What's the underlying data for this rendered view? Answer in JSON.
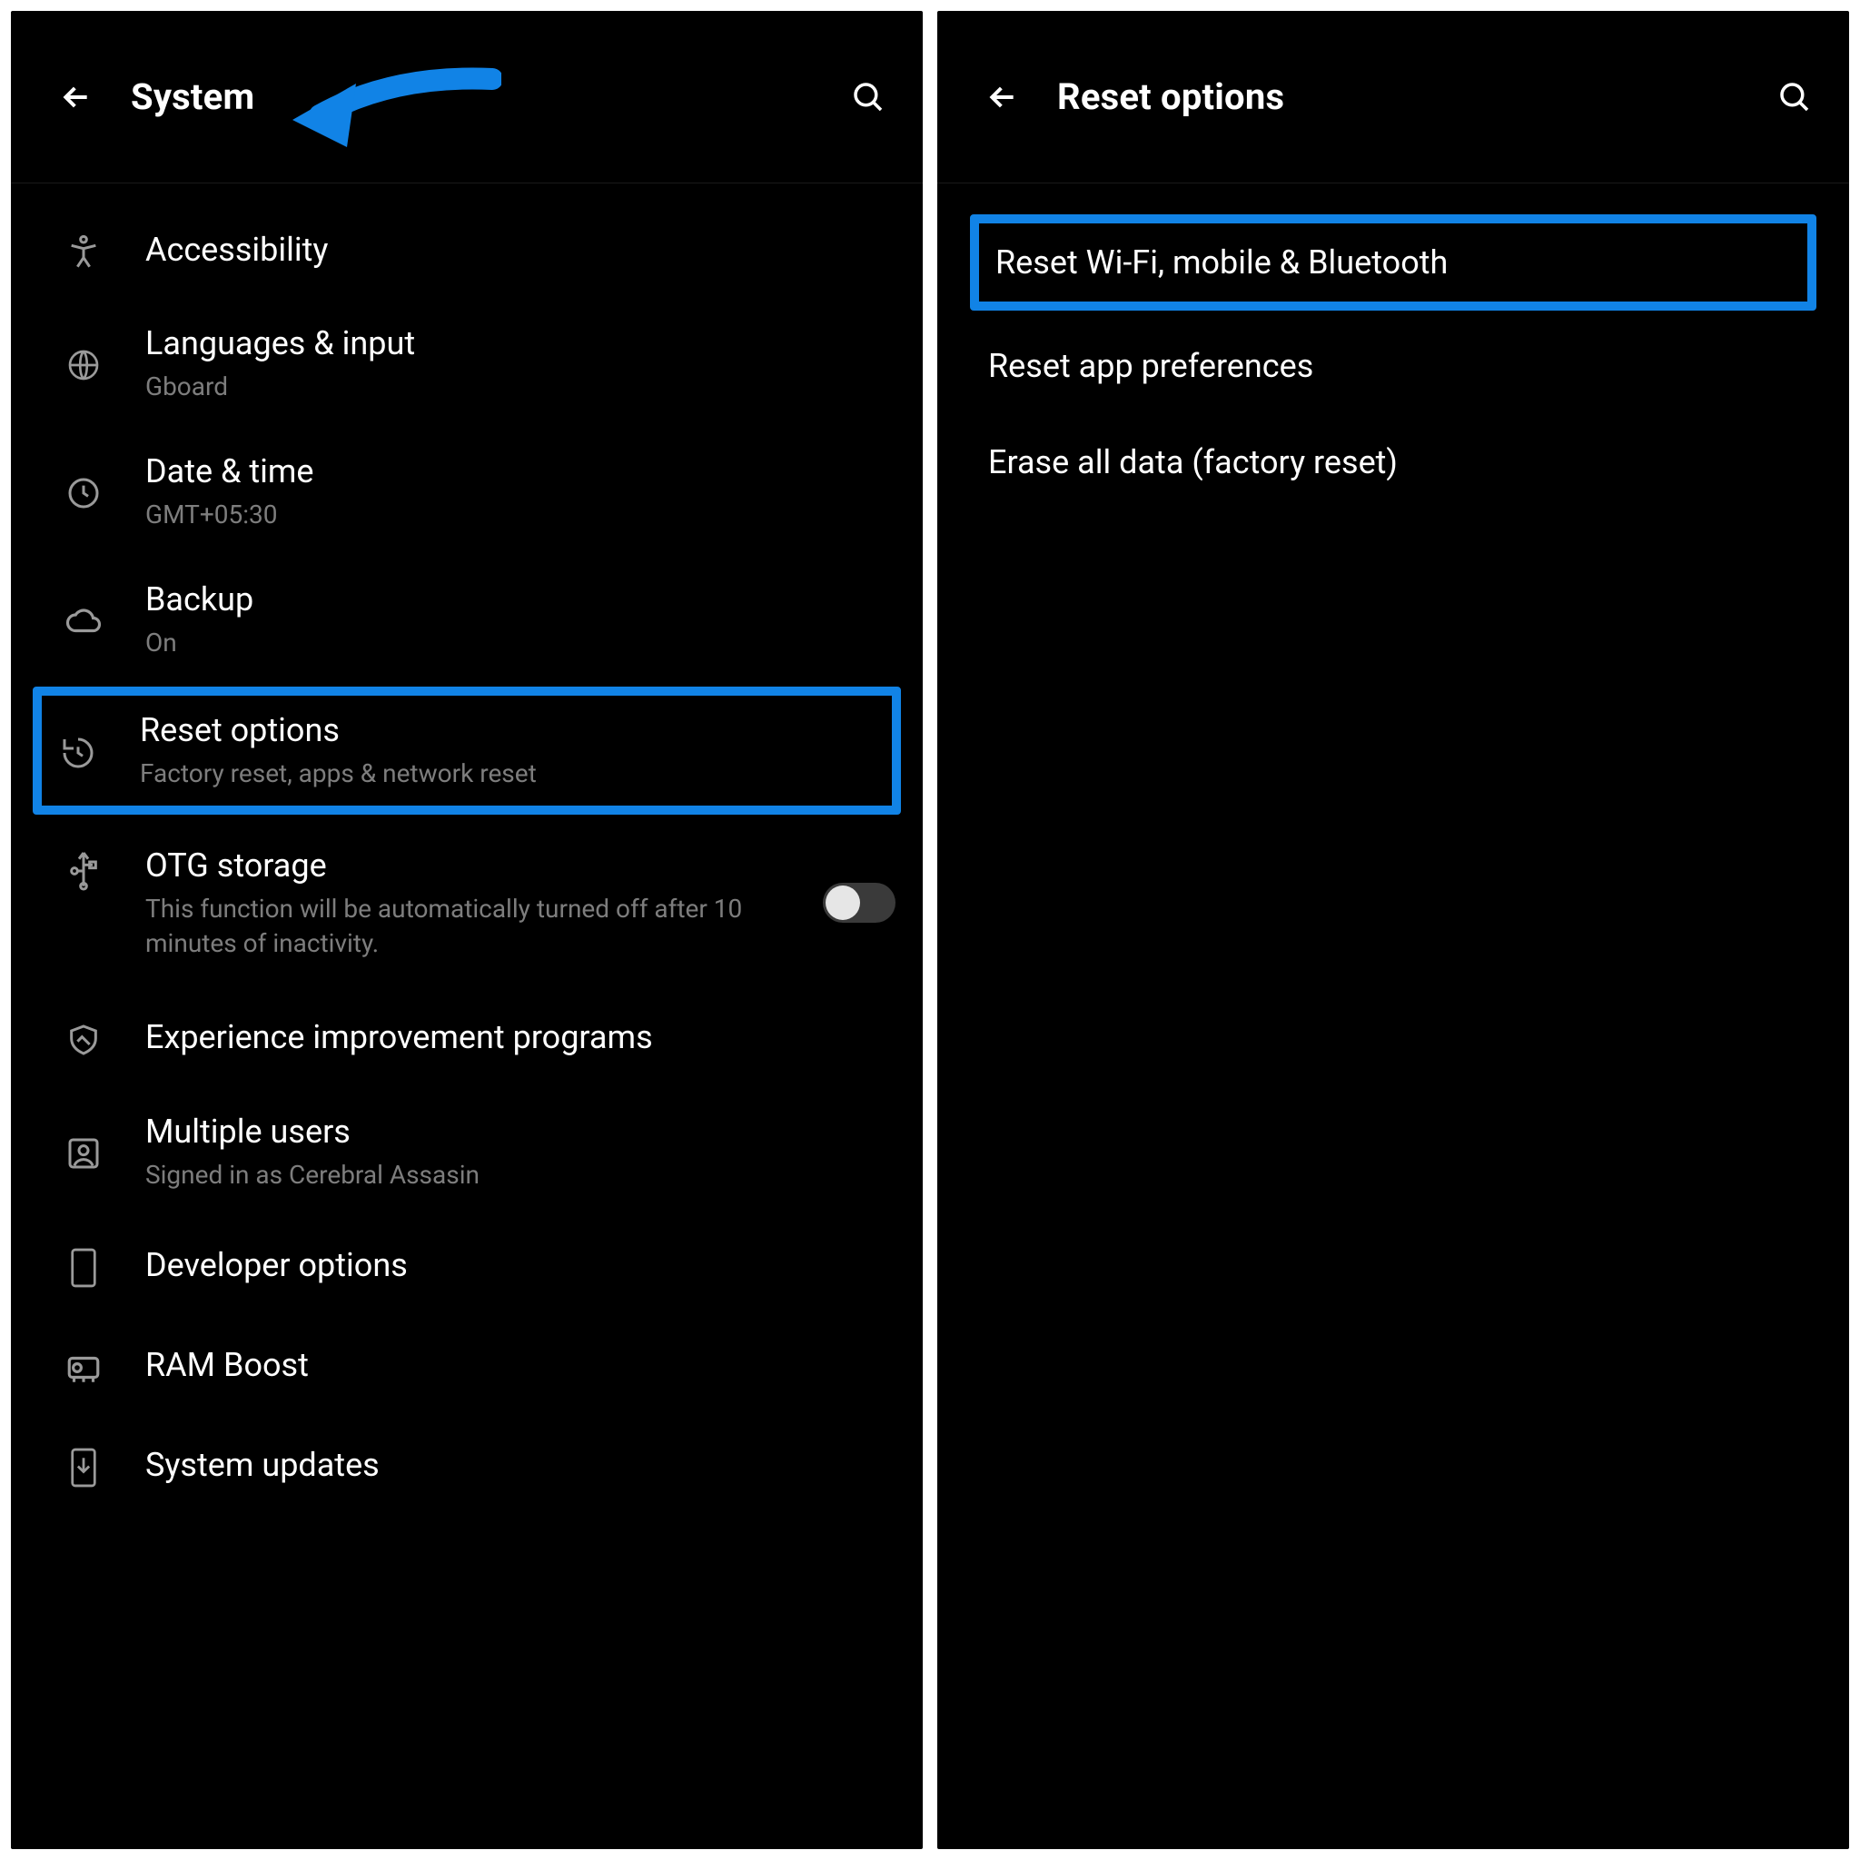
{
  "colors": {
    "highlight": "#1183e6"
  },
  "left": {
    "title": "System",
    "items": [
      {
        "icon": "accessibility",
        "label": "Accessibility",
        "sub": ""
      },
      {
        "icon": "globe",
        "label": "Languages & input",
        "sub": "Gboard"
      },
      {
        "icon": "clock",
        "label": "Date & time",
        "sub": "GMT+05:30"
      },
      {
        "icon": "cloud",
        "label": "Backup",
        "sub": "On"
      },
      {
        "icon": "restore",
        "label": "Reset options",
        "sub": "Factory reset, apps & network reset",
        "highlight": true
      },
      {
        "icon": "usb",
        "label": "OTG storage",
        "sub": "This function will be automatically turned off after 10 minutes of inactivity.",
        "toggle": false
      },
      {
        "icon": "shield-check",
        "label": "Experience improvement programs",
        "sub": ""
      },
      {
        "icon": "person-box",
        "label": "Multiple users",
        "sub": "Signed in as Cerebral Assasin"
      },
      {
        "icon": "phone-outline",
        "label": "Developer options",
        "sub": ""
      },
      {
        "icon": "ram-boost",
        "label": "RAM Boost",
        "sub": ""
      },
      {
        "icon": "system-update",
        "label": "System updates",
        "sub": ""
      }
    ]
  },
  "right": {
    "title": "Reset options",
    "items": [
      {
        "label": "Reset Wi-Fi, mobile & Bluetooth",
        "highlight": true
      },
      {
        "label": "Reset app preferences"
      },
      {
        "label": "Erase all data (factory reset)"
      }
    ]
  }
}
